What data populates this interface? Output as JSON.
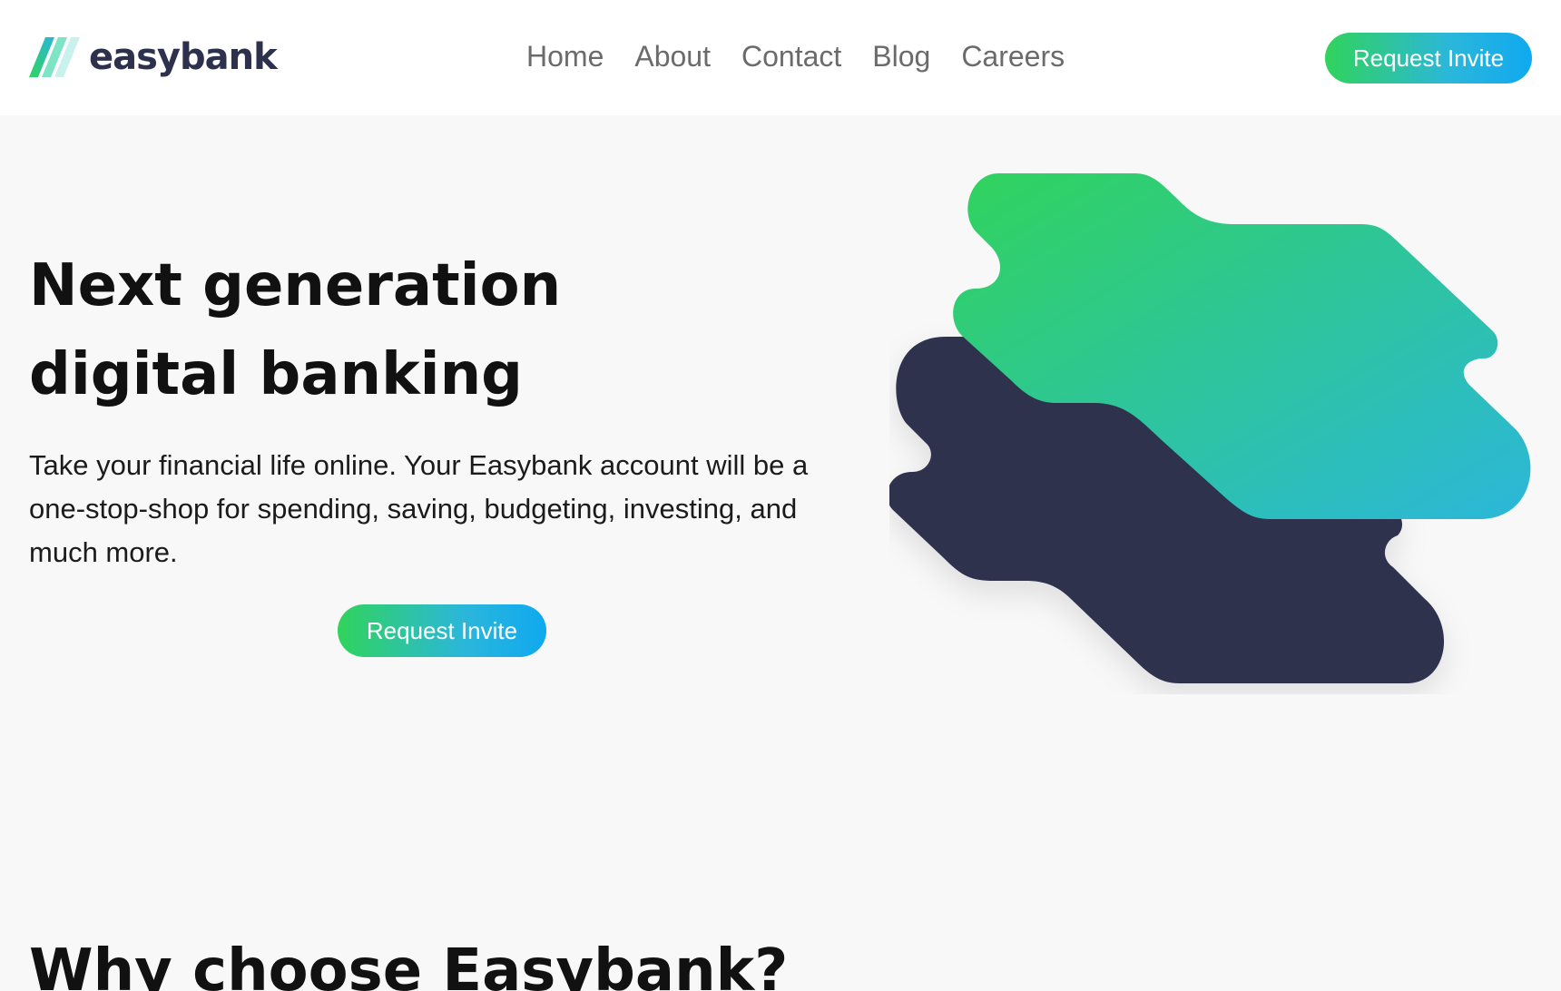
{
  "brand": {
    "name": "easybank",
    "logo_icon": "slanted-stripes-logo-icon",
    "colors": {
      "primary_dark": "#2d314d",
      "accent_green": "#31d35c",
      "accent_cyan": "#2bb7da",
      "background": "#f8f8f8"
    }
  },
  "nav": {
    "items": [
      {
        "label": "Home"
      },
      {
        "label": "About"
      },
      {
        "label": "Contact"
      },
      {
        "label": "Blog"
      },
      {
        "label": "Careers"
      }
    ]
  },
  "header": {
    "cta_label": "Request Invite"
  },
  "hero": {
    "title": "Next generation digital banking",
    "description": "Take your financial life online. Your Easybank account will be a one-stop-shop for spending, saving, budgeting, investing, and much more.",
    "cta_label": "Request Invite"
  },
  "why": {
    "title": "Why choose Easybank?"
  }
}
